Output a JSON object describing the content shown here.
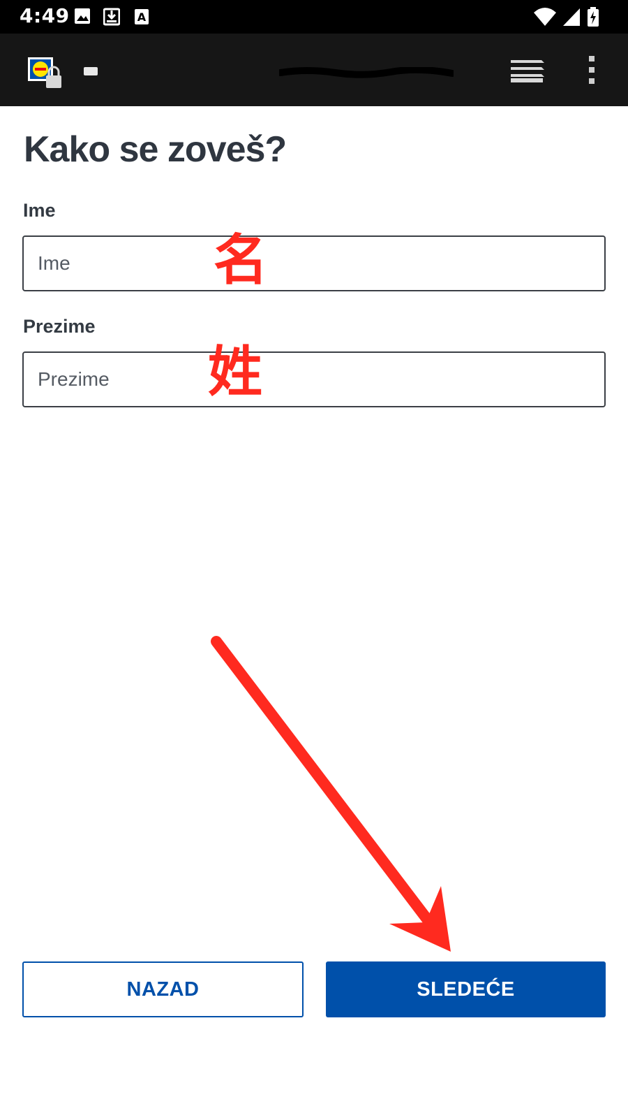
{
  "status_bar": {
    "time": "4:49",
    "left_icons": [
      "image-icon",
      "download-icon",
      "a-notification-icon"
    ],
    "right_icons": [
      "wifi-icon",
      "signal-icon",
      "battery-charging-icon"
    ]
  },
  "browser": {
    "site_icon": "lidl-lock-icon",
    "tabs_icon": "tabs-stack-icon",
    "menu_icon": "overflow-menu-icon"
  },
  "page": {
    "title": "Kako se zoveš?",
    "fields": [
      {
        "label": "Ime",
        "placeholder": "Ime",
        "value": "",
        "annotation": "名"
      },
      {
        "label": "Prezime",
        "placeholder": "Prezime",
        "value": "",
        "annotation": "姓"
      }
    ],
    "buttons": {
      "back_label": "NAZAD",
      "next_label": "SLEDEĆE"
    }
  },
  "colors": {
    "brand_blue": "#0050aa",
    "annotation_red": "#ff2a1f",
    "title_text": "#2f3640",
    "toolbar_bg": "#161616"
  }
}
